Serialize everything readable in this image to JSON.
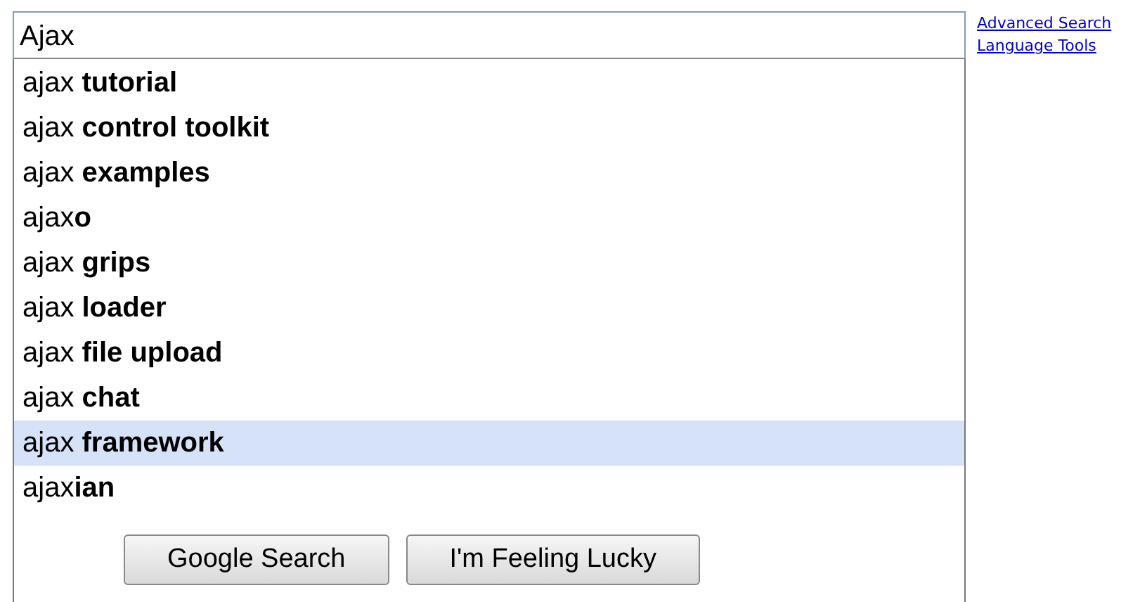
{
  "search": {
    "value": "Ajax"
  },
  "links": [
    "Advanced Search",
    "Language Tools"
  ],
  "suggestions": [
    {
      "text": "ajax **tutorial**",
      "selected": false
    },
    {
      "text": "ajax **control toolkit**",
      "selected": false
    },
    {
      "text": "ajax **examples**",
      "selected": false
    },
    {
      "text": "ajax**o**",
      "selected": false
    },
    {
      "text": "ajax **grips**",
      "selected": false
    },
    {
      "text": "ajax **loader**",
      "selected": false
    },
    {
      "text": "ajax **file upload**",
      "selected": false
    },
    {
      "text": "ajax **chat**",
      "selected": false
    },
    {
      "text": "ajax **framework**",
      "selected": true
    },
    {
      "text": "ajax**ian**",
      "selected": false
    }
  ],
  "buttons": [
    "Google Search",
    "I'm Feeling Lucky"
  ]
}
